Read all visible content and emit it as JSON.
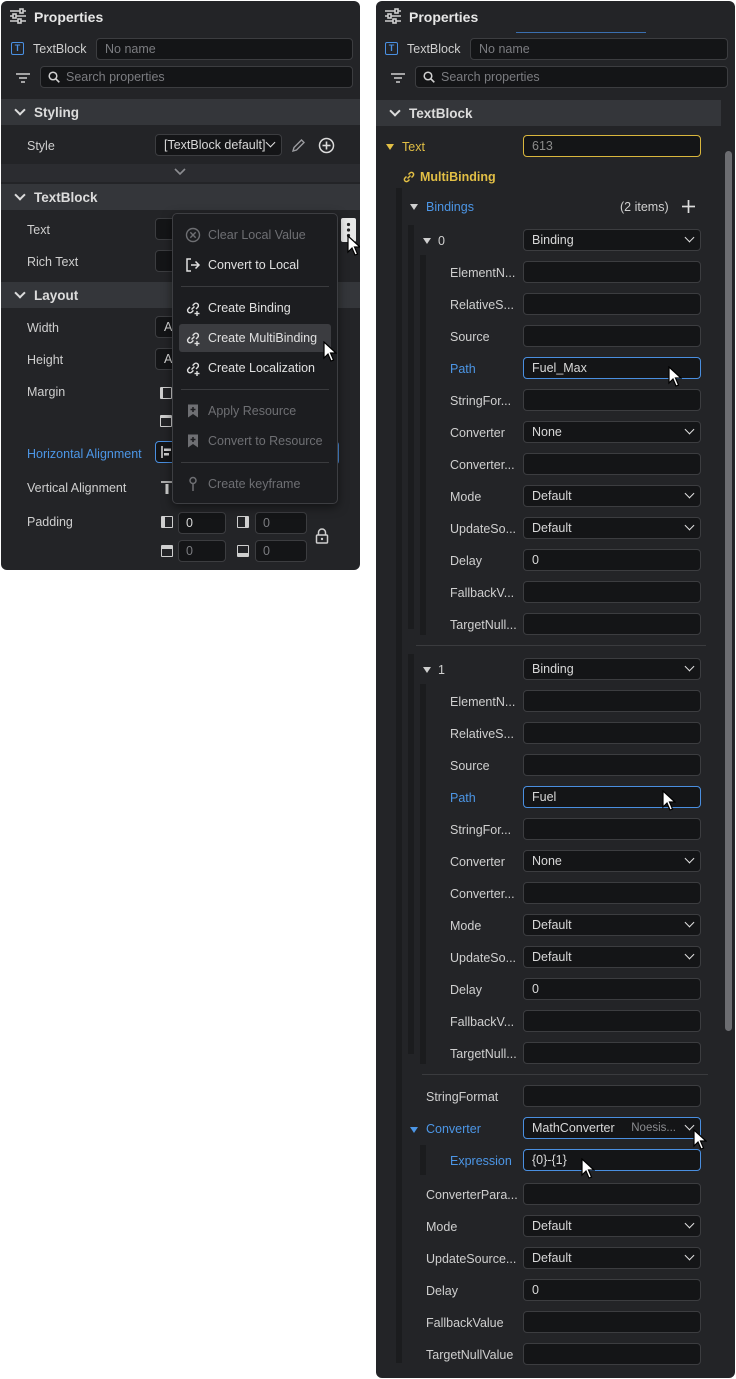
{
  "left_panel": {
    "title": "Properties",
    "element_type": "TextBlock",
    "name_placeholder": "No name",
    "search_placeholder": "Search properties",
    "sections": {
      "styling": "Styling",
      "textblock": "TextBlock",
      "layout": "Layout"
    },
    "style_label": "Style",
    "style_value": "[TextBlock default]",
    "text_label": "Text",
    "rich_text_label": "Rich Text",
    "width_label": "Width",
    "width_value": "A",
    "height_label": "Height",
    "height_value": "A",
    "margin_label": "Margin",
    "horizontal_alignment_label": "Horizontal Alignment",
    "vertical_alignment_label": "Vertical Alignment",
    "padding_label": "Padding",
    "padding": {
      "left": "0",
      "right": "0",
      "top": "0",
      "bottom": "0"
    },
    "context_menu": [
      {
        "label": "Clear Local Value",
        "enabled": false,
        "icon": "clear-circle-icon"
      },
      {
        "label": "Convert to Local",
        "enabled": true,
        "icon": "convert-local-icon"
      },
      {
        "label": "Create Binding",
        "enabled": true,
        "icon": "link-plus-icon"
      },
      {
        "label": "Create MultiBinding",
        "enabled": true,
        "icon": "link-plus-icon",
        "selected": true
      },
      {
        "label": "Create Localization",
        "enabled": true,
        "icon": "link-plus-icon"
      },
      {
        "label": "Apply Resource",
        "enabled": false,
        "icon": "bookmark-plus-icon"
      },
      {
        "label": "Convert to Resource",
        "enabled": false,
        "icon": "bookmark-plus-icon"
      },
      {
        "label": "Create keyframe",
        "enabled": false,
        "icon": "keyframe-icon"
      }
    ]
  },
  "right_panel": {
    "title": "Properties",
    "element_type": "TextBlock",
    "name_placeholder": "No name",
    "search_placeholder": "Search properties",
    "section": "TextBlock",
    "text_label": "Text",
    "text_value": "613",
    "multibinding_label": "MultiBinding",
    "bindings_label": "Bindings",
    "bindings_count": "(2 items)",
    "binding_items": [
      {
        "index": "0",
        "type": "Binding",
        "props": [
          {
            "label": "ElementN...",
            "value": ""
          },
          {
            "label": "RelativeS...",
            "value": ""
          },
          {
            "label": "Source",
            "value": ""
          },
          {
            "label": "Path",
            "value": "Fuel_Max",
            "highlight": true
          },
          {
            "label": "StringFor...",
            "value": ""
          },
          {
            "label": "Converter",
            "value": "None",
            "dropdown": true
          },
          {
            "label": "Converter...",
            "value": ""
          },
          {
            "label": "Mode",
            "value": "Default",
            "dropdown": true
          },
          {
            "label": "UpdateSo...",
            "value": "Default",
            "dropdown": true
          },
          {
            "label": "Delay",
            "value": "0"
          },
          {
            "label": "FallbackV...",
            "value": ""
          },
          {
            "label": "TargetNull...",
            "value": ""
          }
        ]
      },
      {
        "index": "1",
        "type": "Binding",
        "props": [
          {
            "label": "ElementN...",
            "value": ""
          },
          {
            "label": "RelativeS...",
            "value": ""
          },
          {
            "label": "Source",
            "value": ""
          },
          {
            "label": "Path",
            "value": "Fuel",
            "highlight": true
          },
          {
            "label": "StringFor...",
            "value": ""
          },
          {
            "label": "Converter",
            "value": "None",
            "dropdown": true
          },
          {
            "label": "Converter...",
            "value": ""
          },
          {
            "label": "Mode",
            "value": "Default",
            "dropdown": true
          },
          {
            "label": "UpdateSo...",
            "value": "Default",
            "dropdown": true
          },
          {
            "label": "Delay",
            "value": "0"
          },
          {
            "label": "FallbackV...",
            "value": ""
          },
          {
            "label": "TargetNull...",
            "value": ""
          }
        ]
      }
    ],
    "stringformat_label": "StringFormat",
    "converter_label": "Converter",
    "converter_value": "MathConverter",
    "converter_sub": "Noesis...",
    "expression_label": "Expression",
    "expression_value": "{0}-{1}",
    "tail_props": [
      {
        "label": "ConverterPara...",
        "value": ""
      },
      {
        "label": "Mode",
        "value": "Default",
        "dropdown": true
      },
      {
        "label": "UpdateSource...",
        "value": "Default",
        "dropdown": true
      },
      {
        "label": "Delay",
        "value": "0"
      },
      {
        "label": "FallbackValue",
        "value": ""
      },
      {
        "label": "TargetNullValue",
        "value": ""
      }
    ]
  }
}
